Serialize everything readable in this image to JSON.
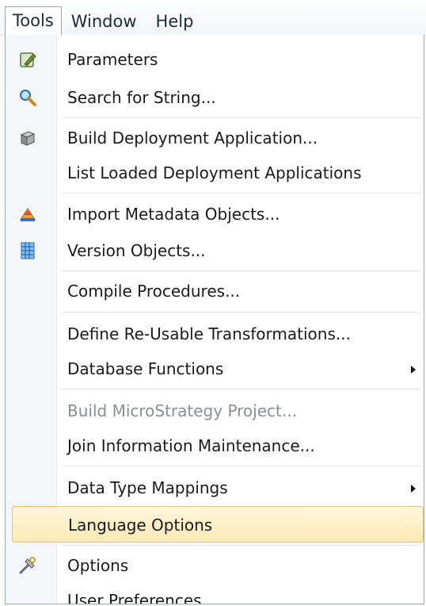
{
  "menubar": {
    "tools": "Tools",
    "window": "Window",
    "help": "Help"
  },
  "menu": {
    "parameters": "Parameters",
    "search_string": "Search for String...",
    "build_deployment": "Build Deployment Application...",
    "list_loaded": "List Loaded Deployment Applications",
    "import_metadata": "Import Metadata Objects...",
    "version_objects": "Version Objects...",
    "compile_procedures": "Compile Procedures...",
    "define_transformations": "Define Re-Usable Transformations...",
    "database_functions": "Database Functions",
    "build_microstrategy": "Build MicroStrategy Project...",
    "join_information": "Join Information Maintenance...",
    "data_type_mappings": "Data Type Mappings",
    "language_options": "Language Options",
    "options": "Options",
    "user_preferences": "User Preferences"
  }
}
